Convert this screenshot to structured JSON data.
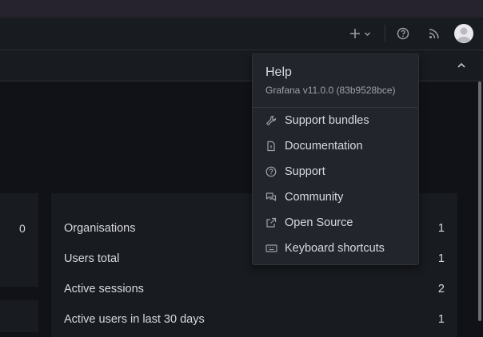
{
  "help_menu": {
    "title": "Help",
    "version": "Grafana v11.0.0 (83b9528bce)",
    "items": [
      {
        "label": "Support bundles",
        "icon": "wrench-icon"
      },
      {
        "label": "Documentation",
        "icon": "document-icon"
      },
      {
        "label": "Support",
        "icon": "question-circle-icon"
      },
      {
        "label": "Community",
        "icon": "comments-icon"
      },
      {
        "label": "Open Source",
        "icon": "external-link-icon"
      },
      {
        "label": "Keyboard shortcuts",
        "icon": "keyboard-icon"
      }
    ]
  },
  "stats": {
    "left_value": "0",
    "rows": [
      {
        "label": "Organisations",
        "value": "1"
      },
      {
        "label": "Users total",
        "value": "1"
      },
      {
        "label": "Active sessions",
        "value": "2"
      },
      {
        "label": "Active users in last 30 days",
        "value": "1"
      }
    ]
  },
  "colors": {
    "background": "#111217",
    "panel": "#181b1f",
    "menu": "#22252b",
    "text": "#d8d9e0",
    "muted": "#9fa1a8"
  }
}
